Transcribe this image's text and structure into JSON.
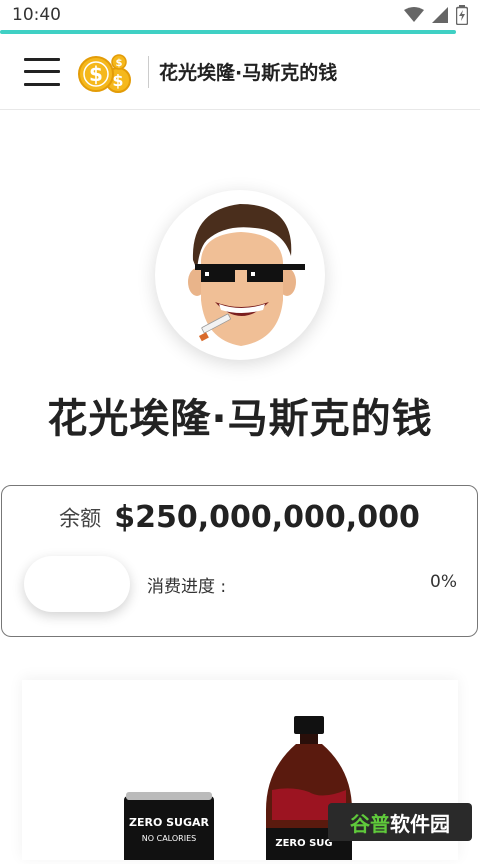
{
  "status_bar": {
    "time": "10:40"
  },
  "app_bar": {
    "title": "花光埃隆·马斯克的钱"
  },
  "hero": {
    "title": "花光埃隆·马斯克的钱"
  },
  "balance": {
    "label": "余额",
    "value": "$250,000,000,000",
    "progress_label": "消费进度 :",
    "progress_value": "0%"
  },
  "products": [
    {
      "can_text": "ZERO SUGAR",
      "can_subtext": "NO CALORIES",
      "bottle_text": "ZERO SUG"
    }
  ],
  "watermark": {
    "part1": "谷普",
    "part2": "软件园"
  },
  "colors": {
    "accent": "#3fd0c4",
    "coin": "#f5b81c",
    "cola_red": "#c8102e"
  }
}
